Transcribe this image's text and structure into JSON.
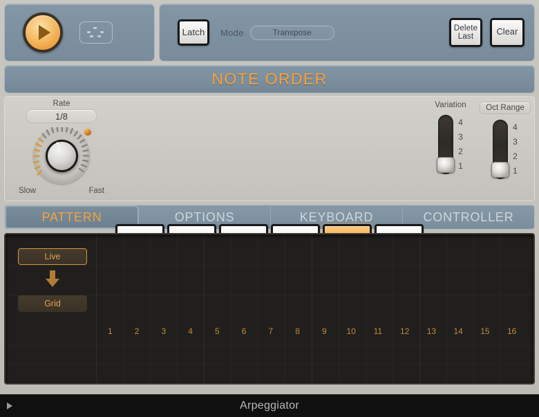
{
  "transport": {
    "play_button": "play-icon",
    "midi_icon": "midi-connector-icon"
  },
  "controls": {
    "latch_label": "Latch",
    "mode_label": "Mode",
    "mode_value": "Transpose",
    "delete_last_line1": "Delete",
    "delete_last_line2": "Last",
    "clear_label": "Clear"
  },
  "section": {
    "title": "NOTE ORDER"
  },
  "rate": {
    "label": "Rate",
    "value": "1/8",
    "min_label": "Slow",
    "max_label": "Fast"
  },
  "note_order_buttons": [
    {
      "name": "up",
      "selected": false
    },
    {
      "name": "down",
      "selected": false
    },
    {
      "name": "up-down",
      "selected": false
    },
    {
      "name": "down-up",
      "selected": false
    },
    {
      "name": "random",
      "selected": true
    },
    {
      "name": "as-played",
      "selected": false
    }
  ],
  "variation": {
    "label": "Variation",
    "scale": [
      "4",
      "3",
      "2",
      "1"
    ],
    "value": "1"
  },
  "oct_range": {
    "label": "Oct Range",
    "scale": [
      "4",
      "3",
      "2",
      "1"
    ],
    "value": "1"
  },
  "tabs": [
    {
      "label": "PATTERN",
      "active": true
    },
    {
      "label": "OPTIONS",
      "active": false
    },
    {
      "label": "KEYBOARD",
      "active": false
    },
    {
      "label": "CONTROLLER",
      "active": false
    }
  ],
  "pattern": {
    "live_label": "Live",
    "grid_label": "Grid",
    "arrow_icon": "down-arrow-icon",
    "steps": [
      "1",
      "2",
      "3",
      "4",
      "5",
      "6",
      "7",
      "8",
      "9",
      "10",
      "11",
      "12",
      "13",
      "14",
      "15",
      "16"
    ]
  },
  "status": {
    "disclosure_icon": "disclosure-triangle-icon",
    "title": "Arpeggiator"
  },
  "colors": {
    "accent_orange": "#f6a23f",
    "panel_blue": "#7d90a0",
    "panel_gray": "#cbc9c3",
    "pattern_dark": "#211f1d"
  }
}
